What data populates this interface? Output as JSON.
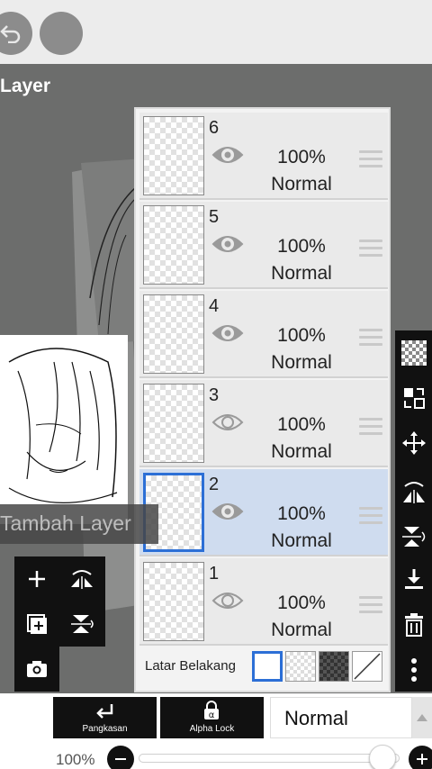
{
  "page_title": "Layer",
  "tooltip": "Tambah Layer",
  "layers": [
    {
      "number": "6",
      "opacity": "100%",
      "blend": "Normal",
      "visible": true,
      "selected": false
    },
    {
      "number": "5",
      "opacity": "100%",
      "blend": "Normal",
      "visible": true,
      "selected": false
    },
    {
      "number": "4",
      "opacity": "100%",
      "blend": "Normal",
      "visible": true,
      "selected": false
    },
    {
      "number": "3",
      "opacity": "100%",
      "blend": "Normal",
      "visible": false,
      "selected": false
    },
    {
      "number": "2",
      "opacity": "100%",
      "blend": "Normal",
      "visible": true,
      "selected": true
    },
    {
      "number": "1",
      "opacity": "100%",
      "blend": "Normal",
      "visible": false,
      "selected": false
    }
  ],
  "background": {
    "label": "Latar Belakang",
    "options": [
      "white",
      "transparent",
      "checker-dark",
      "none"
    ],
    "selected": "white"
  },
  "bottom_bar": {
    "clip_label": "Pangkasan",
    "alpha_lock_label": "Alpha Lock",
    "blend_mode": "Normal",
    "opacity_label": "100%",
    "opacity_value": 1.0
  },
  "icons": {
    "top": [
      "back-icon",
      "menu-icon"
    ],
    "right_toolbar": [
      "checker-icon",
      "layer-transfer-icon",
      "move-icon",
      "flip-horizontal-icon",
      "flip-vertical-icon",
      "merge-down-icon",
      "trash-icon",
      "more-icon"
    ],
    "left_tools": [
      "add-layer-icon",
      "rotate-flip-icon",
      "duplicate-layer-icon",
      "merge-icon",
      "camera-icon"
    ]
  },
  "colors": {
    "accent": "#2c6fd6",
    "selected_row": "#cfdcef",
    "toolbar": "#111111",
    "canvas_bg": "#6c6d6c"
  }
}
